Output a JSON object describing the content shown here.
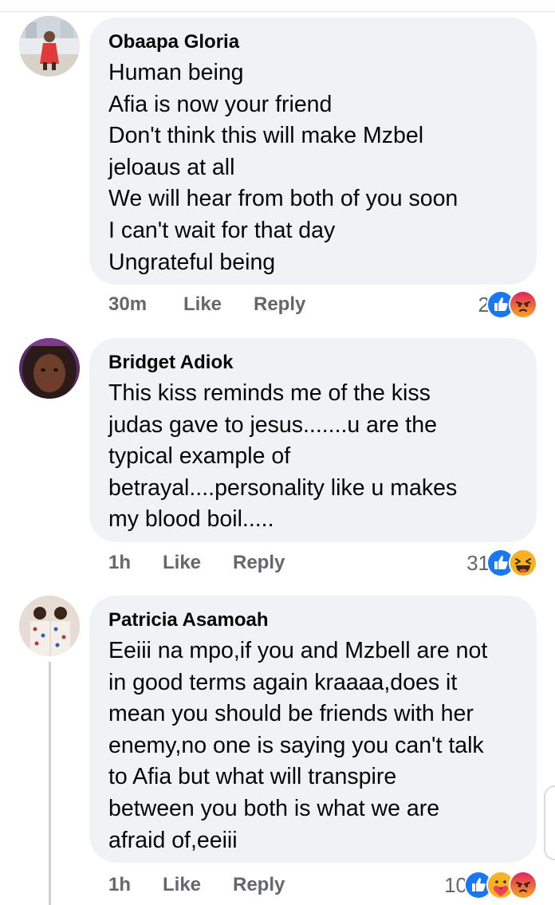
{
  "comments": [
    {
      "author": "Obaapa Gloria",
      "lines": [
        "Human being",
        "Afia is now your friend",
        "Don't think this will make Mzbel",
        "jeloaus at all",
        "We will hear from both of you soon",
        "I can't wait for that day",
        "Ungrateful being"
      ],
      "time": "30m",
      "like_label": "Like",
      "reply_label": "Reply",
      "reaction_count": "2",
      "reactions": [
        "like-icon",
        "angry-icon"
      ]
    },
    {
      "author": "Bridget Adiok",
      "lines": [
        "This kiss reminds me of the kiss",
        "judas gave to jesus.......u are the",
        "typical example of",
        "betrayal....personality like u makes",
        "my blood boil....."
      ],
      "time": "1h",
      "like_label": "Like",
      "reply_label": "Reply",
      "reaction_count": "31",
      "reactions": [
        "like-icon",
        "haha-icon"
      ]
    },
    {
      "author": "Patricia Asamoah",
      "lines": [
        "Eeiii na mpo,if you and Mzbell are not",
        "in good terms again kraaaa,does it",
        "mean you should be friends with her",
        "enemy,no one is saying you can't talk",
        "to Afia but what will transpire",
        "between you both is what we are",
        "afraid of,eeiii"
      ],
      "time": "1h",
      "like_label": "Like",
      "reply_label": "Reply",
      "reaction_count": "10",
      "reactions": [
        "like-icon",
        "care-icon",
        "angry-icon"
      ]
    }
  ],
  "colors": {
    "bubble": "#f0f2f5",
    "meta_text": "#65676b",
    "like_blue": "#1877f2",
    "angry_orange": "#e9710f",
    "haha_yellow": "#f7b125"
  }
}
